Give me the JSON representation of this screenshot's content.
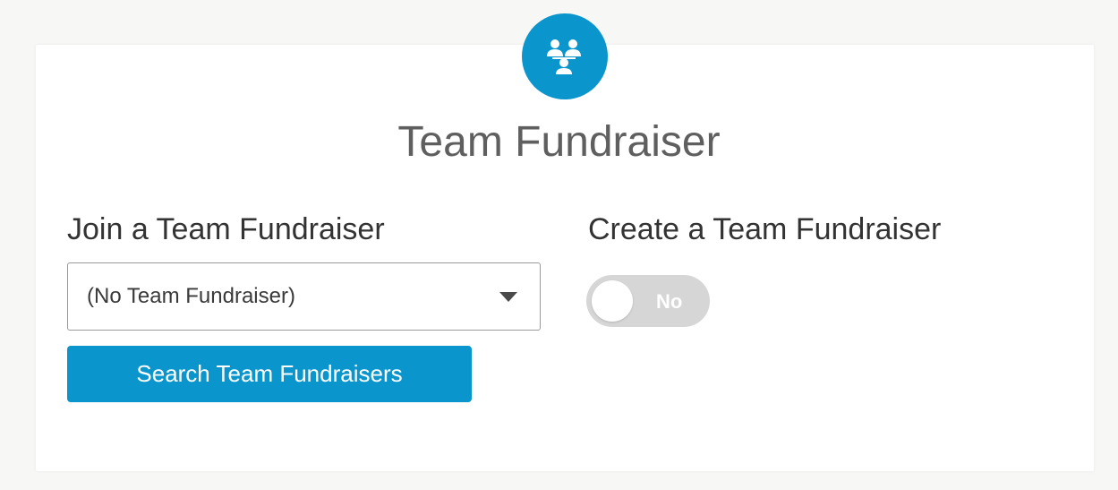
{
  "header": {
    "icon": "team-people-icon",
    "title": "Team Fundraiser"
  },
  "join": {
    "heading": "Join a Team Fundraiser",
    "select_value": "(No Team Fundraiser)",
    "search_button_label": "Search Team Fundraisers"
  },
  "create": {
    "heading": "Create a Team Fundraiser",
    "toggle_label": "No",
    "toggle_state": false
  },
  "colors": {
    "accent": "#0a96cc",
    "toggle_off": "#d6d6d6",
    "title_text": "#5f5f5f"
  }
}
